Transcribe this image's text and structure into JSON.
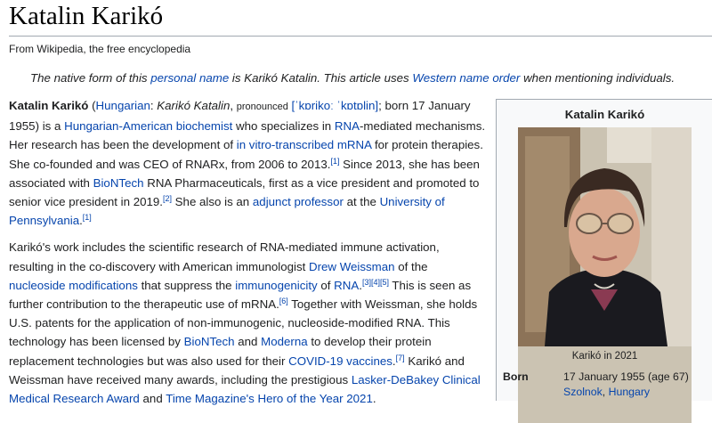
{
  "article": {
    "title": "Katalin Karikó",
    "tagline": "From Wikipedia, the free encyclopedia"
  },
  "hatnote": {
    "t1": "The native form of this ",
    "link1": "personal name",
    "t2": " is Karikó Katalin. This article uses ",
    "link2": "Western name order",
    "t3": " when mentioning individuals."
  },
  "p1": {
    "bold": "Katalin Karikó",
    "t1": " (",
    "link_hungarian": "Hungarian",
    "t2": ": ",
    "native_name": "Karikó Katalin",
    "t3": ", ",
    "pronounced": "pronounced",
    "t3b": " ",
    "ipa": "[ˈkɒrikoː ˈkɒtɒlin]",
    "t4": "; born 17 January 1955) is a ",
    "link_origin": "Hungarian-American",
    "t5": " ",
    "link_biochemist": "biochemist",
    "t6": " who specializes in ",
    "link_rna": "RNA",
    "t7": "-mediated mechanisms. Her research has been the development of ",
    "link_ivt": "in vitro-transcribed mRNA",
    "t8": " for protein therapies. She co-founded and was CEO of RNARx, from 2006 to 2013.",
    "ref_a": "[1]",
    "t9": " Since 2013, she has been associated with ",
    "link_biontech": "BioNTech",
    "t10": " RNA Pharmaceuticals, first as a vice president and promoted to senior vice president in 2019.",
    "ref_b": "[2]",
    "t11": " She also is an ",
    "link_adjunct": "adjunct professor",
    "t12": " at the ",
    "link_upenn": "University of Pennsylvania",
    "t13": ".",
    "ref_c": "[1]"
  },
  "p2": {
    "t1": "Karikó's work includes the scientific research of RNA-mediated immune activation, resulting in the co-discovery with American immunologist ",
    "link_weissman": "Drew Weissman",
    "t2": " of the ",
    "link_nucleoside": "nucleoside modifications",
    "t3": " that suppress the ",
    "link_immuno": "immunogenicity",
    "t4": " of ",
    "link_rna": "RNA",
    "t5": ".",
    "ref_a": "[3][4][5]",
    "t6": " This is seen as further contribution to the therapeutic use of mRNA.",
    "ref_b": "[6]",
    "t7": " Together with Weissman, she holds U.S. patents for the application of non-immunogenic, nucleoside-modified RNA. This technology has been licensed by ",
    "link_biontech": "BioNTech",
    "t8": " and ",
    "link_moderna": "Moderna",
    "t9": " to develop their protein replacement technologies but was also used for their ",
    "link_covid": "COVID-19 vaccines",
    "t10": ".",
    "ref_c": "[7]",
    "t11": " Karikó and Weissman have received many awards, including the prestigious ",
    "link_lasker": "Lasker-DeBakey Clinical Medical Research Award",
    "t12": " and ",
    "link_time": "Time Magazine's Hero of the Year 2021",
    "t13": "."
  },
  "infobox": {
    "title": "Katalin Karikó",
    "caption": "Karikó in 2021",
    "born_label": "Born",
    "born_date": "17 January 1955 (age 67)",
    "born_place_city": "Szolnok",
    "born_place_sep": ", ",
    "born_place_country": "Hungary"
  }
}
